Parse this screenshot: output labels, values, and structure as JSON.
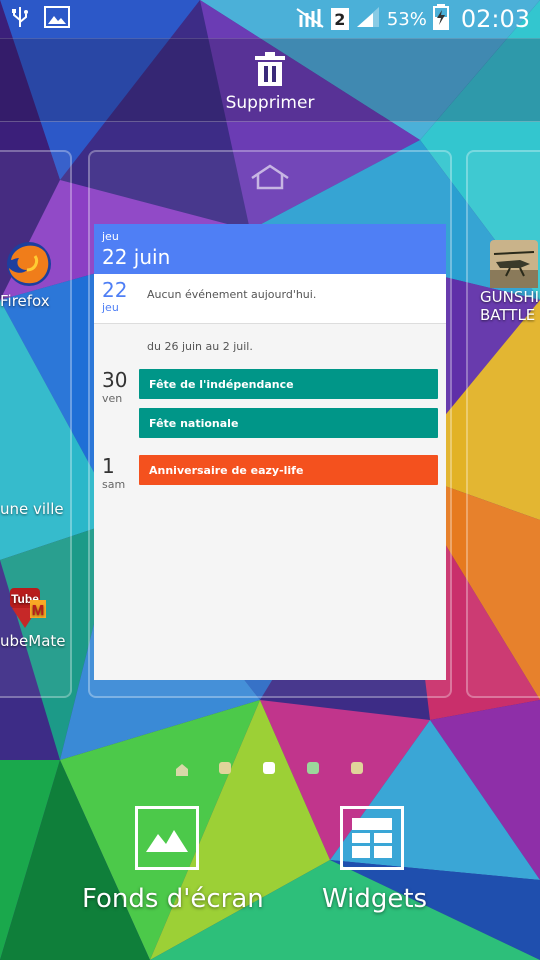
{
  "status_bar": {
    "battery_percent": "53%",
    "time": "02:03",
    "sim_slot": "2",
    "icons": [
      "usb-icon",
      "image-notification-icon",
      "no-signal-icon",
      "signal-icon",
      "battery-charging-icon"
    ]
  },
  "top_bar": {
    "delete_label": "Supprimer"
  },
  "left_panel": {
    "apps": [
      {
        "label": "Firefox",
        "icon": "firefox-icon"
      },
      {
        "label": "une ville",
        "icon": ""
      },
      {
        "label": "ubeMate",
        "icon": "tubemate-icon",
        "logo_text": "Tube M"
      }
    ]
  },
  "right_panel": {
    "apps": [
      {
        "label_line1": "GUNSHI",
        "label_line2": "BATTLE",
        "icon": "gunship-battle-icon"
      }
    ]
  },
  "calendar_widget": {
    "header_day": "jeu",
    "header_date": "22 juin",
    "today_number": "22",
    "today_day": "jeu",
    "no_event_text": "Aucun événement aujourd'hui.",
    "range_text": "du 26 juin au 2 juil.",
    "days": [
      {
        "number": "30",
        "name": "ven",
        "events": [
          {
            "title": "Fête de l'indépendance",
            "color": "#009688"
          },
          {
            "title": "Fête nationale",
            "color": "#009688"
          }
        ]
      },
      {
        "number": "1",
        "name": "sam",
        "events": [
          {
            "title": "Anniversaire de eazy-life",
            "color": "#f4511e"
          }
        ]
      }
    ]
  },
  "page_indicator": {
    "pages": 5,
    "current_index": 2
  },
  "bottom_actions": {
    "wallpaper_label": "Fonds d'écran",
    "widgets_label": "Widgets"
  },
  "colors": {
    "calendar_header": "#4f7ff5",
    "event_teal": "#009688",
    "event_orange": "#f4511e"
  }
}
